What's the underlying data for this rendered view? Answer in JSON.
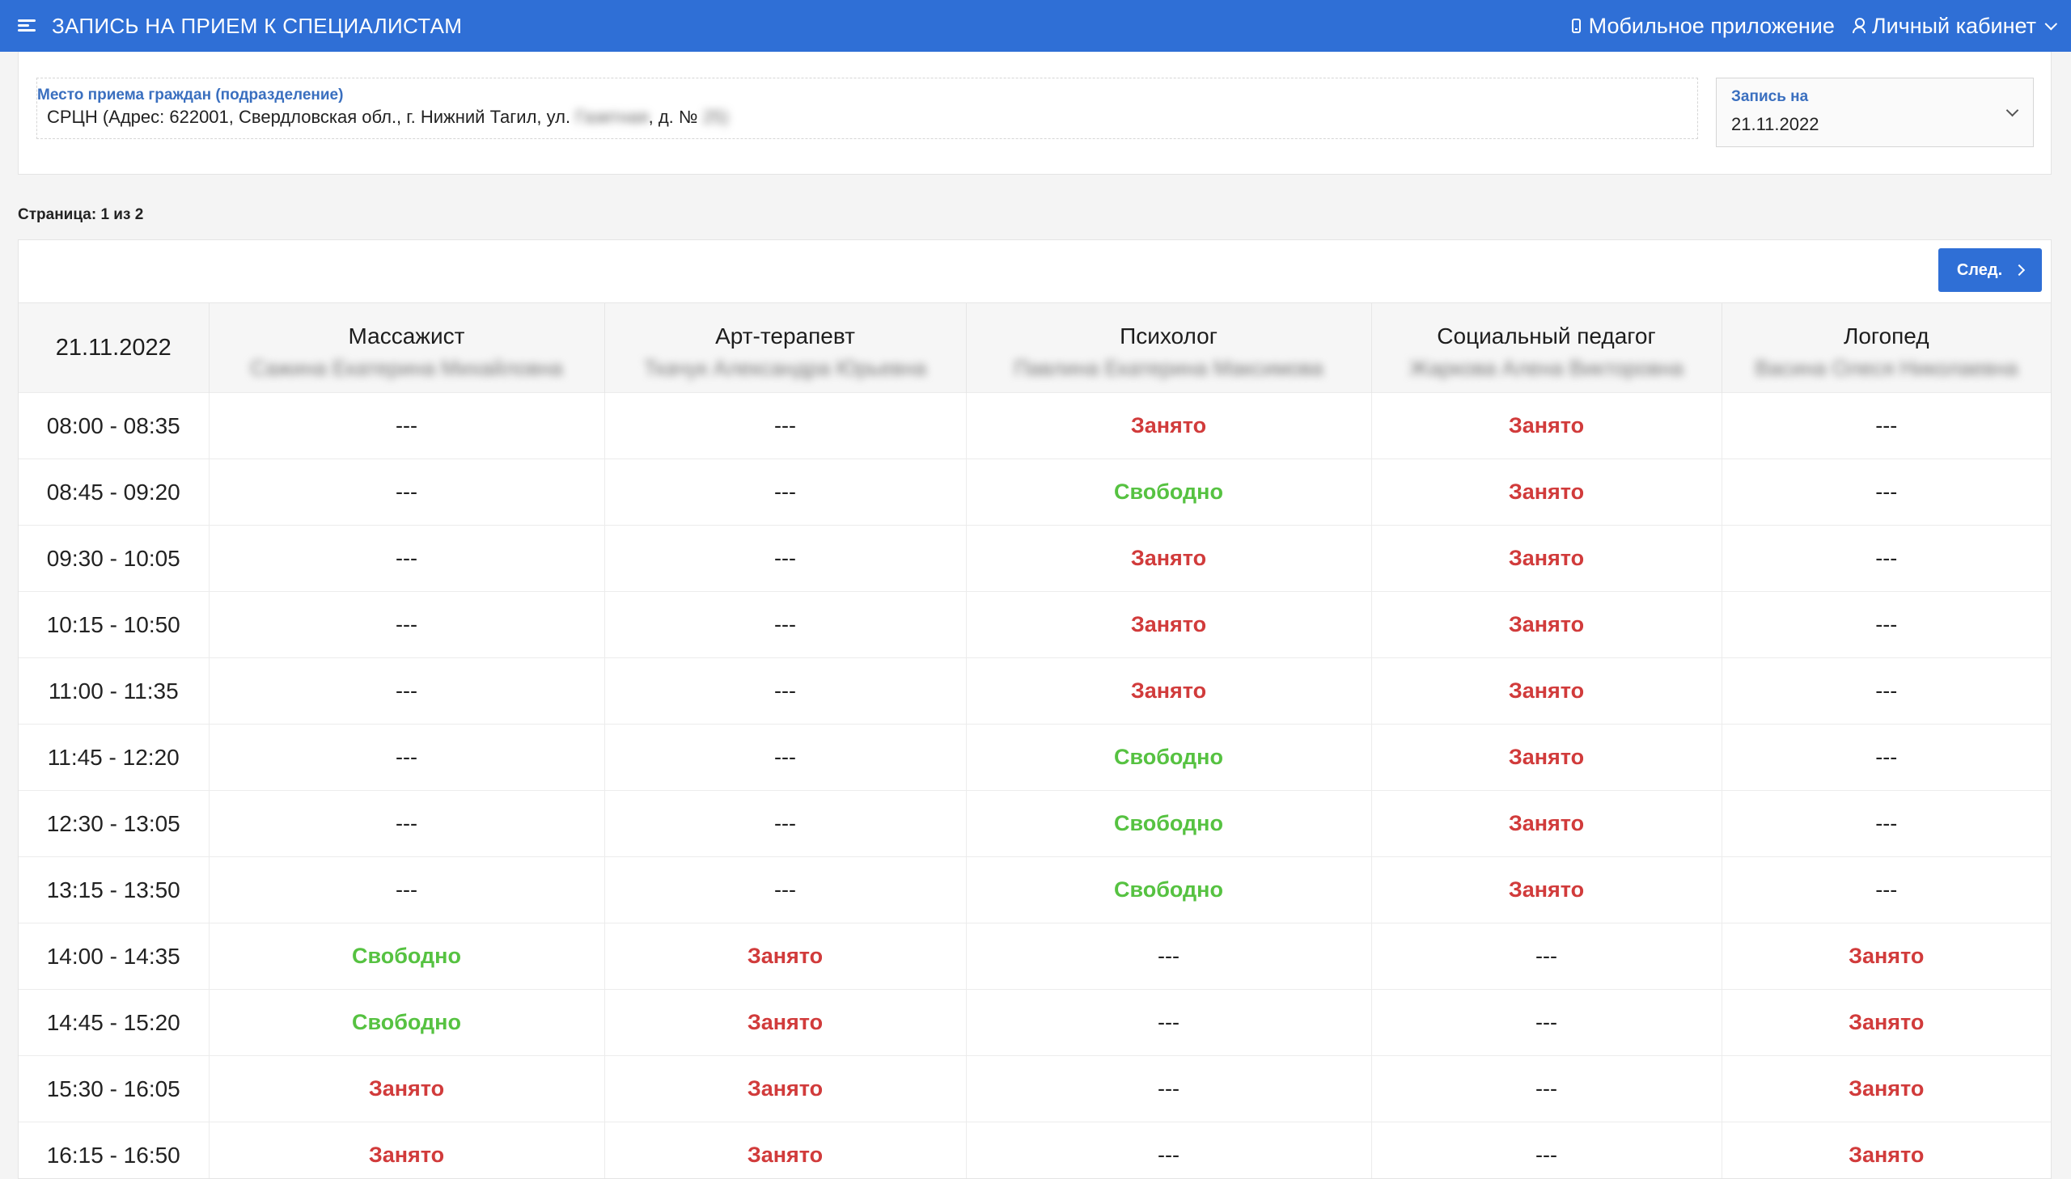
{
  "header": {
    "title": "ЗАПИСЬ НА ПРИЕМ К СПЕЦИАЛИСТАМ",
    "mobile_app": "Мобильное приложение",
    "account": "Личный кабинет"
  },
  "filters": {
    "place_label": "Место приема граждан (подразделение)",
    "place_value_prefix": "СРЦН (Адрес: 622001, Свердловская обл., г. Нижний Тагил, ул.",
    "place_value_street_blurred": "Газетная",
    "place_value_mid": ", д. №",
    "place_value_number_blurred": "25)",
    "date_label": "Запись на",
    "date_value": "21.11.2022"
  },
  "pagination": {
    "page_info": "Страница: 1 из 2",
    "next_label": "След."
  },
  "schedule": {
    "date": "21.11.2022",
    "specialists": [
      {
        "role": "Массажист",
        "name": "Сажина Екатерина Михайловна"
      },
      {
        "role": "Арт-терапевт",
        "name": "Ткачук Александра Юрьевна"
      },
      {
        "role": "Психолог",
        "name": "Павлина Екатерина Максимова"
      },
      {
        "role": "Социальный педагог",
        "name": "Жаркова Алена Викторовна"
      },
      {
        "role": "Логопед",
        "name": "Васина Олеся Николаевна"
      }
    ],
    "rows": [
      {
        "time": "08:00 - 08:35",
        "slots": [
          "---",
          "---",
          "Занято",
          "Занято",
          "---"
        ]
      },
      {
        "time": "08:45 - 09:20",
        "slots": [
          "---",
          "---",
          "Свободно",
          "Занято",
          "---"
        ]
      },
      {
        "time": "09:30 - 10:05",
        "slots": [
          "---",
          "---",
          "Занято",
          "Занято",
          "---"
        ]
      },
      {
        "time": "10:15 - 10:50",
        "slots": [
          "---",
          "---",
          "Занято",
          "Занято",
          "---"
        ]
      },
      {
        "time": "11:00 - 11:35",
        "slots": [
          "---",
          "---",
          "Занято",
          "Занято",
          "---"
        ]
      },
      {
        "time": "11:45 - 12:20",
        "slots": [
          "---",
          "---",
          "Свободно",
          "Занято",
          "---"
        ]
      },
      {
        "time": "12:30 - 13:05",
        "slots": [
          "---",
          "---",
          "Свободно",
          "Занято",
          "---"
        ]
      },
      {
        "time": "13:15 - 13:50",
        "slots": [
          "---",
          "---",
          "Свободно",
          "Занято",
          "---"
        ]
      },
      {
        "time": "14:00 - 14:35",
        "slots": [
          "Свободно",
          "Занято",
          "---",
          "---",
          "Занято"
        ]
      },
      {
        "time": "14:45 - 15:20",
        "slots": [
          "Свободно",
          "Занято",
          "---",
          "---",
          "Занято"
        ]
      },
      {
        "time": "15:30 - 16:05",
        "slots": [
          "Занято",
          "Занято",
          "---",
          "---",
          "Занято"
        ]
      },
      {
        "time": "16:15 - 16:50",
        "slots": [
          "Занято",
          "Занято",
          "---",
          "---",
          "Занято"
        ]
      }
    ]
  },
  "colors": {
    "brand": "#2f6fd6",
    "busy": "#d13b3b",
    "free": "#56c241",
    "label": "#3a6fbf"
  }
}
